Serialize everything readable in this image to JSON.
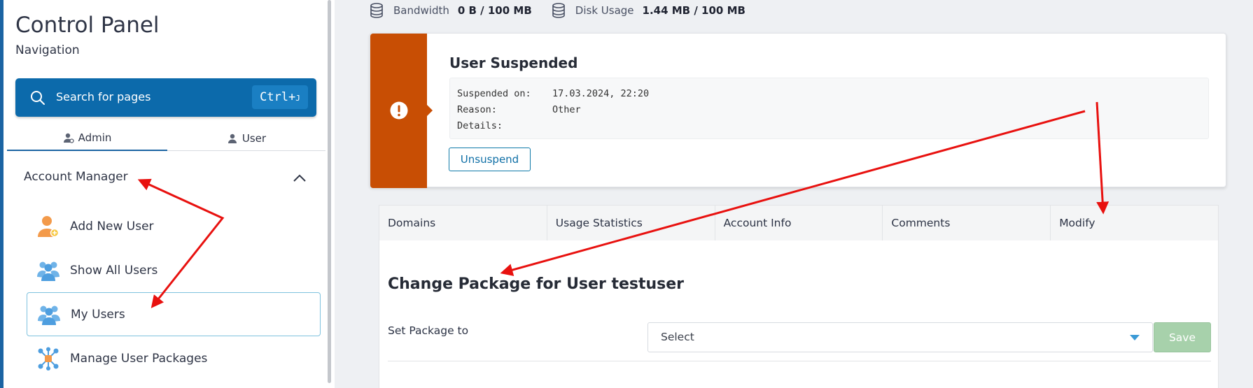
{
  "sidebar": {
    "title": "Control Panel",
    "subtitle": "Navigation",
    "search": {
      "label": "Search for pages",
      "shortcut_main": "Ctrl+",
      "shortcut_key": "J"
    },
    "tabs": [
      {
        "label": "Admin"
      },
      {
        "label": "User"
      }
    ],
    "section": {
      "label": "Account Manager"
    },
    "items": [
      {
        "label": "Add New User",
        "icon": "add-user-icon"
      },
      {
        "label": "Show All Users",
        "icon": "users-group-icon"
      },
      {
        "label": "My Users",
        "icon": "users-group-icon"
      },
      {
        "label": "Manage User Packages",
        "icon": "packages-network-icon"
      }
    ]
  },
  "stats": {
    "bandwidth_label": "Bandwidth",
    "bandwidth_value": "0 B / 100 MB",
    "disk_label": "Disk Usage",
    "disk_value": "1.44 MB / 100 MB"
  },
  "alert": {
    "title": "User Suspended",
    "rows": [
      {
        "key": "Suspended on:",
        "value": "17.03.2024, 22:20"
      },
      {
        "key": "Reason:",
        "value": "Other"
      },
      {
        "key": "Details:",
        "value": ""
      }
    ],
    "button_label": "Unsuspend",
    "color": "#c84e04"
  },
  "page_tabs": [
    {
      "label": "Domains"
    },
    {
      "label": "Usage Statistics"
    },
    {
      "label": "Account Info"
    },
    {
      "label": "Comments"
    },
    {
      "label": "Modify"
    }
  ],
  "panel": {
    "title": "Change Package for User testuser",
    "package_label": "Set Package to",
    "select_value": "Select",
    "save_label": "Save"
  },
  "colors": {
    "accent": "#0c6aab",
    "annotation_arrow": "#e8110f"
  }
}
